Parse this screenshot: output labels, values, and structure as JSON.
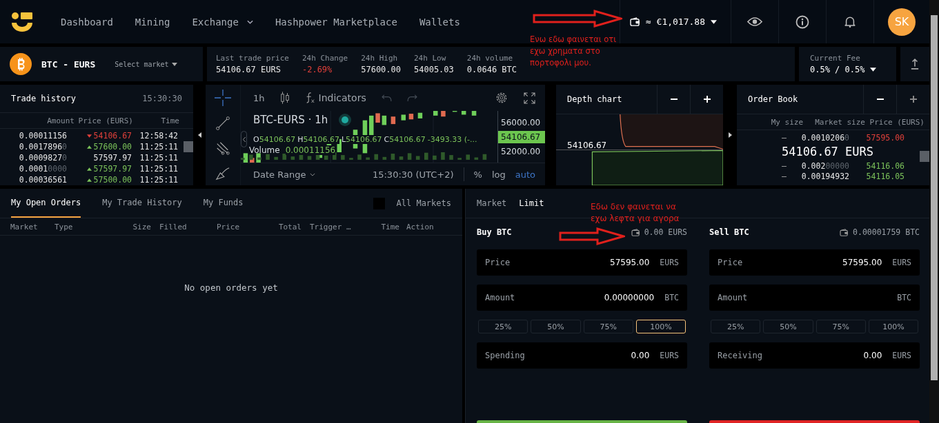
{
  "nav": {
    "items": [
      {
        "label": "Dashboard",
        "dropdown": false
      },
      {
        "label": "Mining",
        "dropdown": false
      },
      {
        "label": "Exchange",
        "dropdown": true
      },
      {
        "label": "Hashpower Marketplace",
        "dropdown": false
      },
      {
        "label": "Wallets",
        "dropdown": false
      }
    ],
    "balance": "≈ €1,017.88",
    "avatar": "SK"
  },
  "market": {
    "pair": "BTC - EURS",
    "select": "Select market",
    "stats": [
      {
        "label": "Last trade price",
        "value": "54106.67 EURS",
        "negative": false
      },
      {
        "label": "24h Change",
        "value": "-2.69%",
        "negative": true
      },
      {
        "label": "24h High",
        "value": "57600.00",
        "negative": false
      },
      {
        "label": "24h Low",
        "value": "54005.03",
        "negative": false
      },
      {
        "label": "24h volume",
        "value": "0.0646 BTC",
        "negative": false
      }
    ],
    "fee": {
      "label": "Current Fee",
      "value": "0.5% / 0.5%"
    }
  },
  "trade_history": {
    "title": "Trade history",
    "time": "15:30:30",
    "columns": [
      "Amount",
      "Price (EURS)",
      "Time"
    ],
    "rows": [
      {
        "kind": "down",
        "amount": "0.00011156",
        "price": "54106.67",
        "time": "12:58:42"
      },
      {
        "kind": "up",
        "amount": "0.0017896",
        "amount_dim": "0",
        "price": "57600.00",
        "time": "11:25:11"
      },
      {
        "kind": "flat",
        "amount": "0.0009827",
        "amount_dim": "0",
        "price": "57597.97",
        "time": "11:25:11"
      },
      {
        "kind": "up",
        "amount": "0.0001",
        "amount_dim": "0000",
        "price": "57597.97",
        "time": "11:25:11"
      },
      {
        "kind": "up",
        "amount": "0.00036561",
        "price": "57500.00",
        "time": "11:25:11"
      }
    ]
  },
  "chart": {
    "interval": "1h",
    "indicators": "Indicators",
    "title": "BTC-EURS · 1h",
    "legend": [
      {
        "key": "O",
        "value": "54106.67"
      },
      {
        "key": "H",
        "value": "54106.67"
      },
      {
        "key": "L",
        "value": "54106.67"
      },
      {
        "key": "C",
        "value": "54106.67"
      }
    ],
    "change": "-3493.33 (-...",
    "volume_label": "Volume",
    "volume": "0.00011156",
    "price_labels": [
      {
        "text": "56000.00",
        "current": false
      },
      {
        "text": "54106.67",
        "current": true
      },
      {
        "text": "52000.00",
        "current": false
      }
    ],
    "date_range": "Date Range",
    "clock": "15:30:30 (UTC+2)",
    "scales": [
      {
        "label": "%",
        "selected": false
      },
      {
        "label": "log",
        "selected": false
      },
      {
        "label": "auto",
        "selected": true
      }
    ]
  },
  "depth": {
    "title": "Depth chart",
    "price": "54106.67"
  },
  "order_book": {
    "title": "Order Book",
    "columns": [
      "My size",
      "Market size",
      "Price (EURS)"
    ],
    "rows": [
      {
        "kind": "ask",
        "my_size": "–",
        "size": "0.0010206",
        "size_dim": "0",
        "price": "57595.00"
      },
      {
        "kind": "mid",
        "price": "54106.67 EURS"
      },
      {
        "kind": "bid",
        "my_size": "–",
        "size": "0.002",
        "size_dim": "00000",
        "price": "54116.06"
      },
      {
        "kind": "bid",
        "my_size": "–",
        "size": "0.00194932",
        "price": "54116.05"
      }
    ]
  },
  "orders": {
    "tabs": [
      {
        "label": "My Open Orders",
        "selected": true
      },
      {
        "label": "My Trade History",
        "selected": false
      },
      {
        "label": "My Funds",
        "selected": false
      }
    ],
    "all_markets": {
      "label": "All Markets",
      "checked": false
    },
    "columns": [
      "Market",
      "Type",
      "Size",
      "Filled",
      "Price",
      "Total",
      "Trigger …",
      "Time",
      "Action"
    ],
    "empty": "No open orders yet"
  },
  "form": {
    "tabs": [
      {
        "label": "Market",
        "selected": false
      },
      {
        "label": "Limit",
        "selected": true
      }
    ],
    "panels": [
      {
        "kind": "buy",
        "title": "Buy BTC",
        "balance": "0.00 EURS",
        "fields": [
          {
            "label": "Price",
            "value": "57595.00",
            "unit": "EURS"
          },
          {
            "label": "Amount",
            "value": "0.00000000",
            "unit": "BTC"
          }
        ],
        "percents": [
          {
            "label": "25%",
            "selected": false
          },
          {
            "label": "50%",
            "selected": false
          },
          {
            "label": "75%",
            "selected": false
          },
          {
            "label": "100%",
            "selected": true
          }
        ],
        "total": {
          "label": "Spending",
          "value": "0.00",
          "unit": "EURS"
        }
      },
      {
        "kind": "sell",
        "title": "Sell BTC",
        "balance": "0.00001759 BTC",
        "fields": [
          {
            "label": "Price",
            "value": "57595.00",
            "unit": "EURS"
          },
          {
            "label": "Amount",
            "unit": "BTC"
          }
        ],
        "percents": [
          {
            "label": "25%",
            "selected": false
          },
          {
            "label": "50%",
            "selected": false
          },
          {
            "label": "75%",
            "selected": false
          },
          {
            "label": "100%",
            "selected": false
          }
        ],
        "total": {
          "label": "Receiving",
          "value": "0.00",
          "unit": "EURS"
        }
      }
    ]
  },
  "annotations": [
    {
      "text": "Ενω εδω φαινεται οτι εχω χρηματα στο πορτοφολι μου."
    },
    {
      "text": "Εδω δεν φαινεται να εχω λεφτα για αγορα"
    }
  ]
}
